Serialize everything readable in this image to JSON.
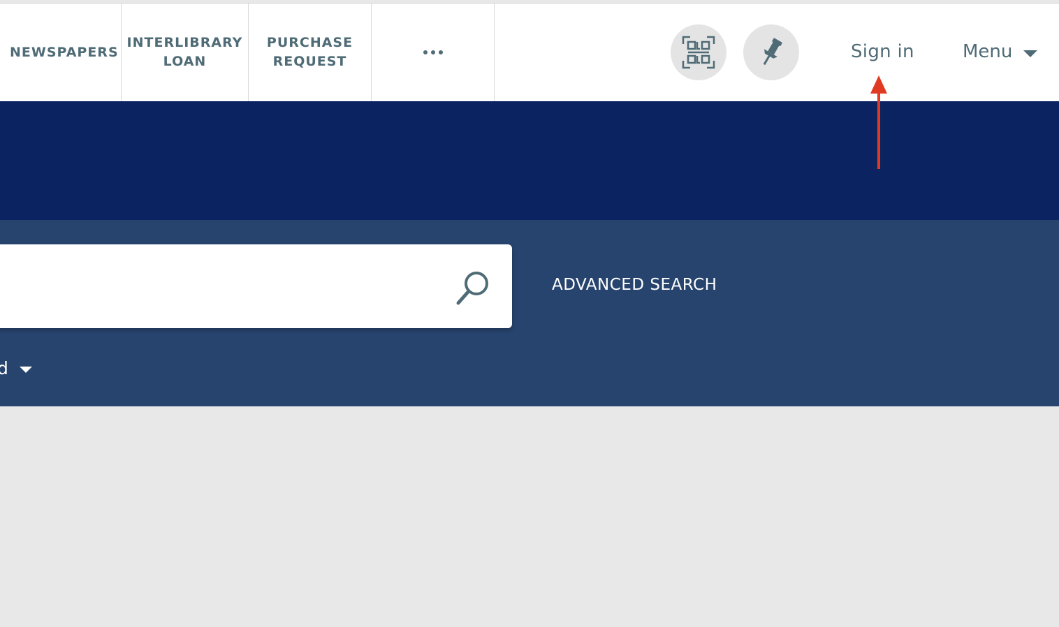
{
  "nav": {
    "newspapers": "NEWSPAPERS",
    "interlibrary_loan": "INTERLIBRARY\nLOAN",
    "purchase_request": "PURCHASE\nREQUEST"
  },
  "header": {
    "sign_in": "Sign in",
    "menu": "Menu"
  },
  "search": {
    "placeholder": "",
    "advanced_label": "ADVANCED SEARCH",
    "scope_label": "d"
  },
  "icons": [
    "more-icon",
    "qr-code-icon",
    "pin-icon",
    "chevron-down-icon",
    "search-icon",
    "arrow-annotation"
  ],
  "colors": {
    "nav_text": "#4f6b76",
    "banner": "#0b2360",
    "search_band": "#27446e",
    "annotation": "#e03a25"
  }
}
